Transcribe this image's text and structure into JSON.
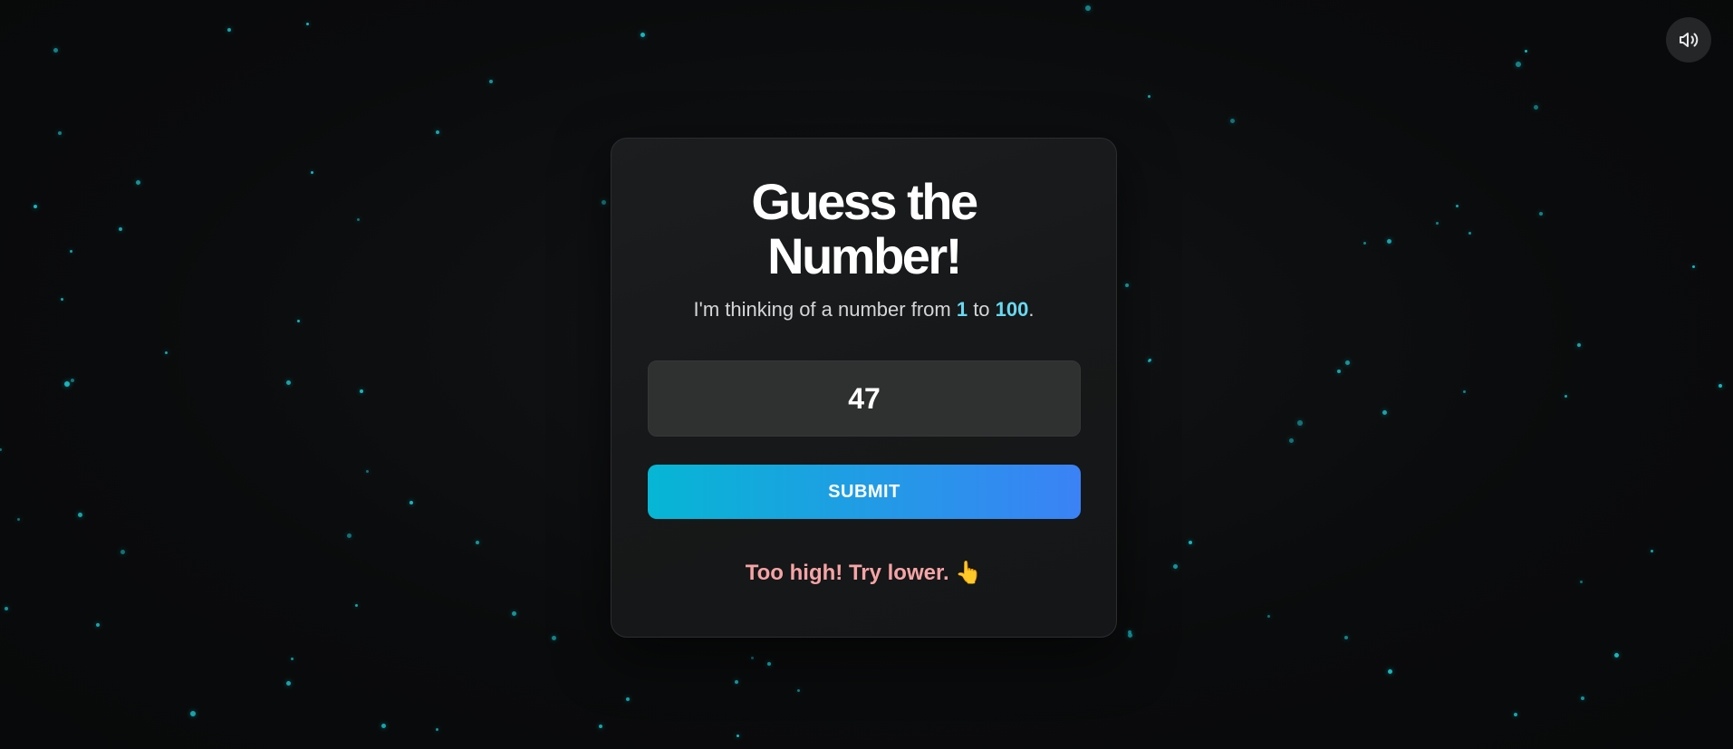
{
  "header": {
    "sound_icon": "speaker-volume-icon"
  },
  "game": {
    "title_line1": "Guess the",
    "title_line2": "Number!",
    "subtitle_prefix": "I'm thinking of a number from ",
    "range_min": "1",
    "subtitle_mid": " to ",
    "range_max": "100",
    "subtitle_suffix": ".",
    "guess_value": "47",
    "submit_label": "SUBMIT",
    "feedback_text": "Too high! Try lower.",
    "feedback_emoji": "👆"
  },
  "colors": {
    "background": "#0b0c0d",
    "card": "#161819",
    "accent": "#67d9f2",
    "star": "#19c6cf",
    "button_gradient_start": "#06b6d4",
    "button_gradient_end": "#3b82f6",
    "feedback": "#f7a4a6"
  }
}
